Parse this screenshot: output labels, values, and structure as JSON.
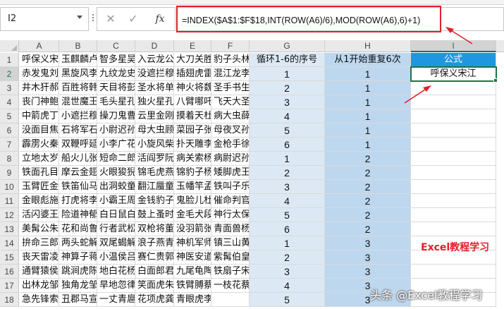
{
  "name_box": {
    "value": "I2"
  },
  "formula_bar": {
    "fx_label": "fx",
    "formula": "=INDEX($A$1:$F$18,INT(ROW(A6)/6),MOD(ROW(A6),6)+1)"
  },
  "columns": [
    "A",
    "B",
    "C",
    "D",
    "E",
    "F",
    "G",
    "H",
    "I"
  ],
  "selected_column": "I",
  "selected_row": 2,
  "rows": [
    {
      "n": "1",
      "A": "呼保义宋江",
      "B": "玉麒麟卢俊义",
      "C": "智多星吴用",
      "D": "入云龙公孙胜",
      "E": "大刀关胜",
      "F": "豹子头林冲",
      "G": "循环1-6的序号",
      "H": "从1开始重复6次",
      "I": "公式"
    },
    {
      "n": "2",
      "A": "赤发鬼刘唐",
      "B": "黑旋风李逵",
      "C": "九纹龙史进",
      "D": "没遮拦穆弘",
      "E": "插翅虎雷横",
      "F": "混江龙李俊",
      "G": "1",
      "H": "1",
      "I": "呼保义宋江"
    },
    {
      "n": "3",
      "A": "井木犴郝思文",
      "B": "百胜将韩滔",
      "C": "天目将彭玘",
      "D": "圣水将单廷珪",
      "E": "神火将魏定国",
      "F": "圣手书生萧让",
      "G": "2",
      "H": "1",
      "I": ""
    },
    {
      "n": "4",
      "A": "丧门神鲍旭",
      "B": "混世魔王樊瑞",
      "C": "毛头星孔明",
      "D": "独火星孔亮",
      "E": "八臂哪吒项充",
      "F": "飞天大圣李衮",
      "G": "3",
      "H": "1",
      "I": ""
    },
    {
      "n": "5",
      "A": "中箭虎丁得孙",
      "B": "小遮拦穆春",
      "C": "操刀鬼曹正",
      "D": "云里金刚宋万",
      "E": "摸着天杜迁",
      "F": "病大虫薛永",
      "G": "4",
      "H": "1",
      "I": ""
    },
    {
      "n": "6",
      "A": "没面目焦挺",
      "B": "石将军石勇",
      "C": "小尉迟孙新",
      "D": "母大虫顾大嫂",
      "E": "菜园子张青",
      "F": "母夜叉孙二娘",
      "G": "5",
      "H": "1",
      "I": ""
    },
    {
      "n": "7",
      "A": "霹雳火秦明",
      "B": "双鞭呼延灼",
      "C": "小李广花荣",
      "D": "小旋风柴进",
      "E": "扑天雕李应",
      "F": "金枪手徐宁",
      "G": "6",
      "H": "1",
      "I": ""
    },
    {
      "n": "8",
      "A": "立地太岁阮小二",
      "B": "船火儿张横",
      "C": "短命二郎阮小五",
      "D": "活阎罗阮小七",
      "E": "病关索杨雄",
      "F": "病尉迟孙立",
      "G": "1",
      "H": "2",
      "I": ""
    },
    {
      "n": "9",
      "A": "铁面孔目裴宣",
      "B": "摩云金翅欧鹏",
      "C": "火眼狻猊邓飞",
      "D": "锦毛虎燕顺",
      "E": "锦豹子杨林",
      "F": "矮脚虎王英",
      "G": "2",
      "H": "2",
      "I": ""
    },
    {
      "n": "10",
      "A": "玉臂匠金大坚",
      "B": "铁笛仙马麟",
      "C": "出洞蛟童威",
      "D": "翻江蜃童猛",
      "E": "玉幡竿孟康",
      "F": "铁叫子乐和",
      "G": "3",
      "H": "2",
      "I": ""
    },
    {
      "n": "11",
      "A": "金眼彪施恩",
      "B": "打虎将李忠",
      "C": "小霸王周通",
      "D": "金钱豹子汤隆",
      "E": "鬼脸儿杜兴",
      "F": "催命判官李立",
      "G": "4",
      "H": "2",
      "I": ""
    },
    {
      "n": "12",
      "A": "活闪婆王定六",
      "B": "险道神郁保四",
      "C": "白日鼠白胜",
      "D": "鼓上蚤时迁",
      "E": "金毛犬段景住",
      "F": "神行太保戴宗",
      "G": "5",
      "H": "2",
      "I": ""
    },
    {
      "n": "13",
      "A": "美髯公朱仝",
      "B": "花和尚鲁智深",
      "C": "行者武松",
      "D": "双枪将董平",
      "E": "没羽箭张清",
      "F": "青面兽杨志",
      "G": "6",
      "H": "2",
      "I": ""
    },
    {
      "n": "14",
      "A": "拚命三郎石秀",
      "B": "两头蛇解珍",
      "C": "双尾蝎解宝",
      "D": "浪子燕青",
      "E": "神机军师朱武",
      "F": "镇三山黄信",
      "G": "1",
      "H": "3",
      "I": ""
    },
    {
      "n": "15",
      "A": "丧天雷凌振",
      "B": "神算子蒋敬",
      "C": "小温侯吕方",
      "D": "赛仁贵郭盛",
      "E": "神医安道全",
      "F": "紫髯伯皇甫端",
      "G": "2",
      "H": "3",
      "I": ""
    },
    {
      "n": "16",
      "A": "通臂猿侯健",
      "B": "跳涧虎陈达",
      "C": "地白花杨春",
      "D": "白面郎君郑天寿",
      "E": "九尾龟陶宗旺",
      "F": "铁扇子宋清",
      "G": "3",
      "H": "3",
      "I": ""
    },
    {
      "n": "17",
      "A": "出林龙邹渊",
      "B": "独角龙邹润",
      "C": "旱地忽律朱贵",
      "D": "笑面虎朱富",
      "E": "铁臂膊蔡福",
      "F": "一枝花蔡庆",
      "G": "4",
      "H": "3",
      "I": ""
    },
    {
      "n": "18",
      "A": "急先锋索超",
      "B": "丑郡马宣赞",
      "C": "一丈青扈三娘",
      "D": "花项虎龚旺",
      "E": "青眼虎李云。",
      "F": "",
      "G": "5",
      "H": "3",
      "I": ""
    }
  ],
  "watermarks": {
    "red": "Excel教程学习",
    "footer": "头条 @Excel教程学习"
  },
  "colors": {
    "highlight_red": "#e0202a",
    "header_blue": "#2196e0",
    "col_g_fill": "#dce9f5",
    "col_h_fill": "#bdd7ee",
    "selection_green": "#217346"
  }
}
